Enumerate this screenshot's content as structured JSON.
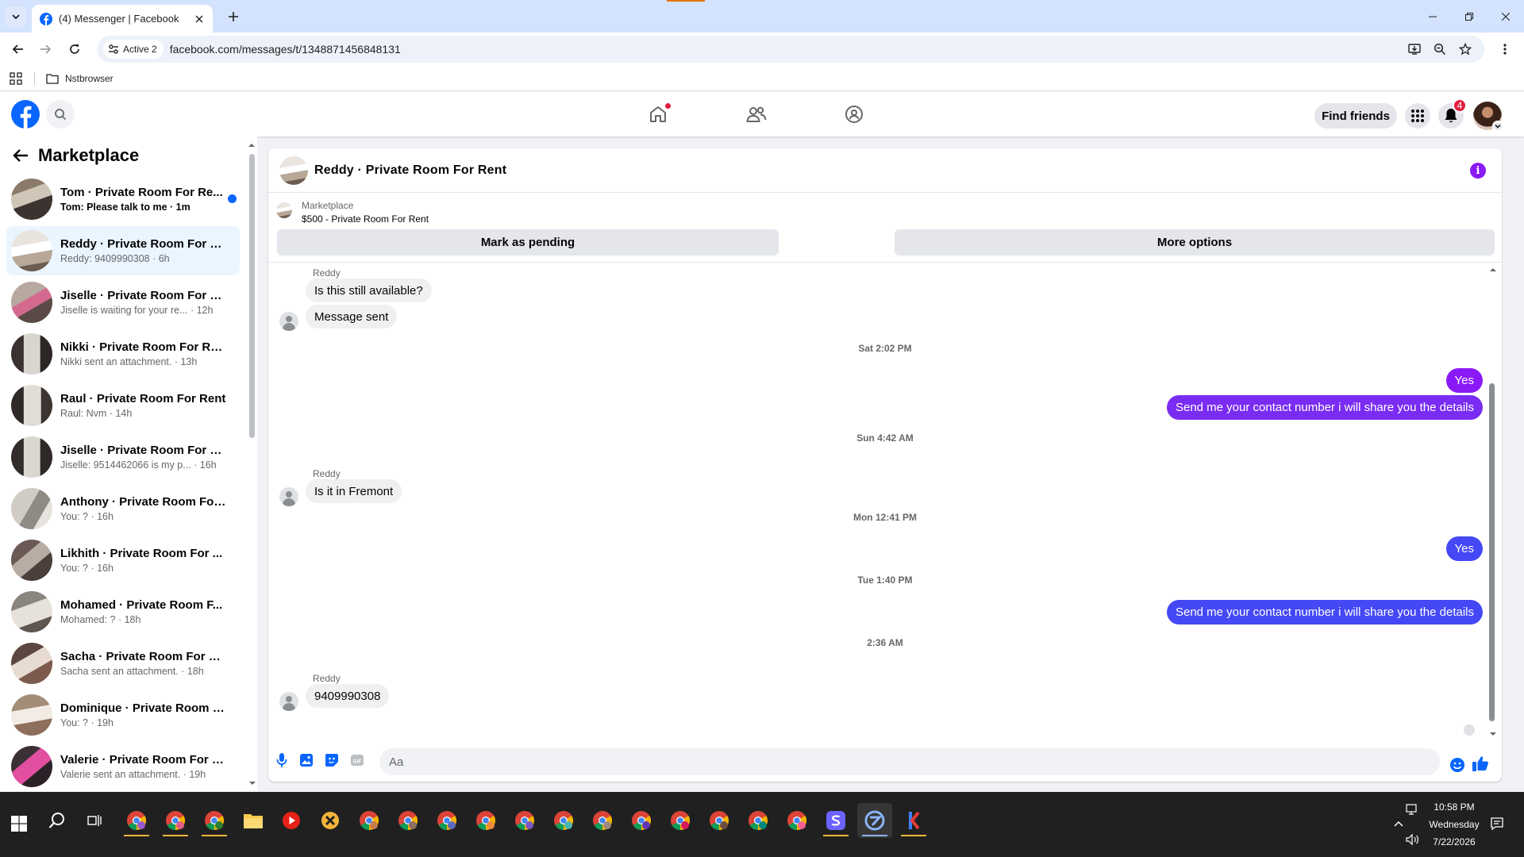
{
  "browser": {
    "tab_title": "(4) Messenger | Facebook",
    "site_chip": "Active 2",
    "url": "facebook.com/messages/t/1348871456848131",
    "bookmark_folder": "Nstbrowser"
  },
  "fb_header": {
    "find_friends": "Find friends",
    "notification_count": "4"
  },
  "sidebar": {
    "title": "Marketplace",
    "conversations": [
      {
        "name": "Tom · Private Room For Re...",
        "sub": "Tom: Please talk to me · 1m",
        "unread": true,
        "active": false
      },
      {
        "name": "Reddy · Private Room For R...",
        "sub": "Reddy: 9409990308 · 6h",
        "unread": false,
        "active": true
      },
      {
        "name": "Jiselle · Private Room For R...",
        "sub": "Jiselle is waiting for your re... · 12h",
        "unread": false,
        "active": false
      },
      {
        "name": "Nikki · Private Room For Rent",
        "sub": "Nikki sent an attachment. · 13h",
        "unread": false,
        "active": false
      },
      {
        "name": "Raul · Private Room For Rent",
        "sub": "Raul: Nvm · 14h",
        "unread": false,
        "active": false
      },
      {
        "name": "Jiselle · Private Room For R...",
        "sub": "Jiselle: 9514462066 is my p... · 16h",
        "unread": false,
        "active": false
      },
      {
        "name": "Anthony · Private Room For...",
        "sub": "You: ? · 16h",
        "unread": false,
        "active": false
      },
      {
        "name": "Likhith · Private Room For ...",
        "sub": "You: ? · 16h",
        "unread": false,
        "active": false
      },
      {
        "name": "Mohamed · Private Room F...",
        "sub": "Mohamed: ? · 18h",
        "unread": false,
        "active": false
      },
      {
        "name": "Sacha · Private Room For R...",
        "sub": "Sacha sent an attachment. · 18h",
        "unread": false,
        "active": false
      },
      {
        "name": "Dominique · Private Room F...",
        "sub": "You: ? · 19h",
        "unread": false,
        "active": false
      },
      {
        "name": "Valerie · Private Room For R...",
        "sub": "Valerie sent an attachment. · 19h",
        "unread": false,
        "active": false
      }
    ]
  },
  "chat": {
    "title": "Reddy · Private Room For Rent",
    "listing_source": "Marketplace",
    "listing_title": "$500 - Private Room For Rent",
    "mark_pending": "Mark as pending",
    "more_options": "More options",
    "sender_name": "Reddy",
    "messages": {
      "in1": "Is this still available?",
      "in2": "Message sent",
      "ts1": "Sat 2:02 PM",
      "out1": "Yes",
      "out2": "Send me your contact number i will share you the details",
      "ts2": "Sun 4:42 AM",
      "in3": "Is it in Fremont",
      "ts3": "Mon 12:41 PM",
      "out3": "Yes",
      "ts4": "Tue 1:40 PM",
      "out4": "Send me your contact number i will share you the details",
      "ts5": "2:36 AM",
      "in4": "9409990308"
    },
    "composer_placeholder": "Aa",
    "accent_color": "#8a19f7"
  },
  "taskbar": {
    "time": "10:58 PM",
    "day": "Wednesday",
    "date": "7/22/2026"
  }
}
